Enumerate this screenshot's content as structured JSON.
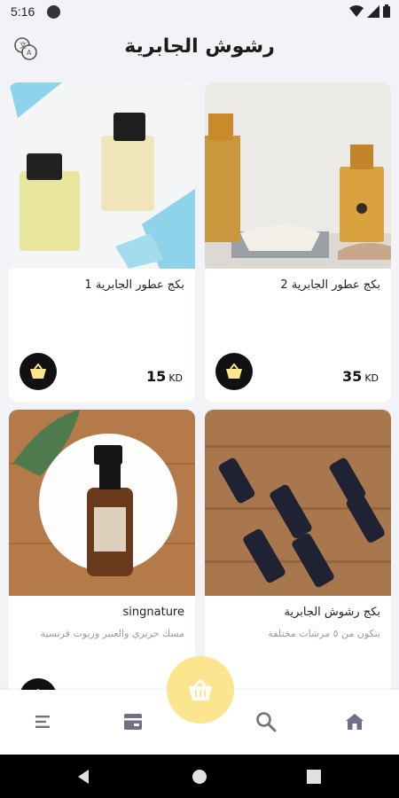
{
  "status_bar": {
    "time": "5:16",
    "icons": [
      "app-notification-icon",
      "wifi-icon",
      "cellular-icon",
      "battery-icon"
    ]
  },
  "header": {
    "title": "رشوش الجابرية",
    "translate_icon": "translate-icon"
  },
  "products": [
    {
      "name": "بكج عطور الجابرية 2",
      "description": "",
      "price": "35",
      "currency": "KD"
    },
    {
      "name": "بكج عطور الجابرية 1",
      "description": "",
      "price": "15",
      "currency": "KD"
    },
    {
      "name": "بكج رشوش الجابرية",
      "description": "يتكون من ٥ مرشات مختلفة",
      "price": "",
      "currency": ""
    },
    {
      "name": "singnature",
      "description": "مسك حريري والعنبر وزيوت فرنسية",
      "price": "",
      "currency": ""
    }
  ],
  "bottom_nav": {
    "items": [
      "home-icon",
      "search-icon",
      "categories-icon",
      "menu-icon"
    ],
    "fab_icon": "basket-icon"
  },
  "colors": {
    "background": "#f2f3f7",
    "card": "#ffffff",
    "cart_button": "#111111",
    "fab": "#fbe58e",
    "nav_icon": "#6e7087"
  }
}
